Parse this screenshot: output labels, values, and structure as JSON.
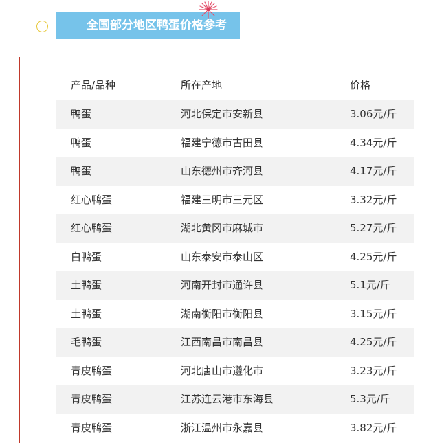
{
  "title": "全国部分地区鸭蛋价格参考",
  "colors": {
    "title_bg": "#76c3ea",
    "accent_rule": "#c0392b",
    "circle": "#e7c83a",
    "stripe": "#f2f2f2"
  },
  "table": {
    "headers": [
      "产品/品种",
      "所在产地",
      "价格"
    ],
    "rows": [
      [
        "鸭蛋",
        "河北保定市安新县",
        "3.06元/斤"
      ],
      [
        "鸭蛋",
        "福建宁德市古田县",
        "4.34元/斤"
      ],
      [
        "鸭蛋",
        "山东德州市齐河县",
        "4.17元/斤"
      ],
      [
        "红心鸭蛋",
        "福建三明市三元区",
        "3.32元/斤"
      ],
      [
        "红心鸭蛋",
        "湖北黄冈市麻城市",
        "5.27元/斤"
      ],
      [
        "白鸭蛋",
        "山东泰安市泰山区",
        "4.25元/斤"
      ],
      [
        "土鸭蛋",
        "河南开封市通许县",
        "5.1元/斤"
      ],
      [
        "土鸭蛋",
        "湖南衡阳市衡阳县",
        "3.15元/斤"
      ],
      [
        "毛鸭蛋",
        "江西南昌市南昌县",
        "4.25元/斤"
      ],
      [
        "青皮鸭蛋",
        "河北唐山市遵化市",
        "3.23元/斤"
      ],
      [
        "青皮鸭蛋",
        "江苏连云港市东海县",
        "5.3元/斤"
      ],
      [
        "青皮鸭蛋",
        "浙江温州市永嘉县",
        "3.82元/斤"
      ]
    ]
  }
}
